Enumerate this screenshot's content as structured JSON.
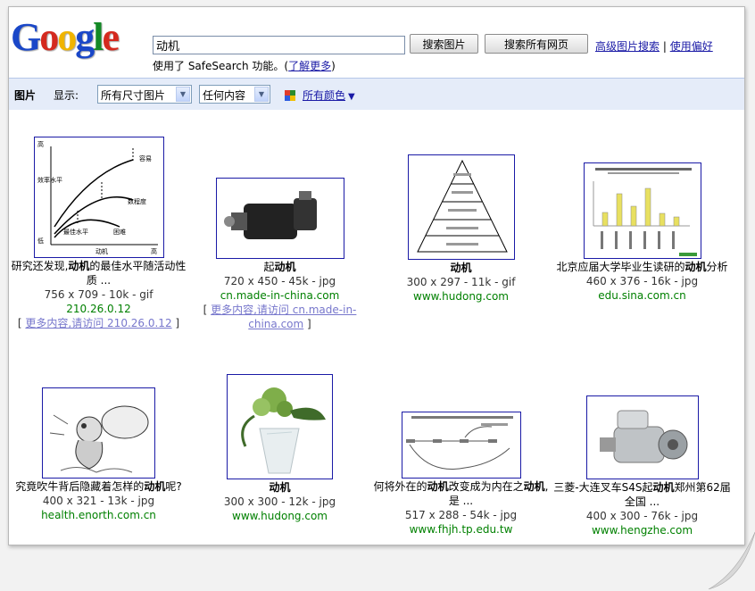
{
  "header": {
    "logo": [
      "G",
      "o",
      "o",
      "g",
      "l",
      "e"
    ],
    "logo_colors": [
      "#1a47c8",
      "#d42a1f",
      "#f0b400",
      "#1a47c8",
      "#138a26",
      "#d42a1f"
    ],
    "search_value": "动机",
    "btn_search_images": "搜索图片",
    "btn_search_web": "搜索所有网页",
    "link_advanced": "高级图片搜索",
    "separator": "|",
    "link_prefs": "使用偏好",
    "safesearch_prefix": "使用了  SafeSearch 功能。(",
    "safesearch_link": "了解更多",
    "safesearch_suffix": ")"
  },
  "toolbar": {
    "title": "图片",
    "show_label": "显示:",
    "size_select": "所有尺寸图片",
    "type_select": "任何内容",
    "color_link": "所有颜色",
    "color_arrow": "▼",
    "color_squares": [
      "#e03c2c",
      "#2c8c2c",
      "#2c5ce0",
      "#f0c000"
    ]
  },
  "results": [
    {
      "cap_pre": "研究还发现,",
      "cap_bold": "动机",
      "cap_post": "的最佳水平随活动性质  ...",
      "meta": "756 x 709 - 10k - gif",
      "host": "210.26.0.12",
      "more_pre": "[ ",
      "more_link": "更多内容,请访问  210.26.0.12",
      "more_post": " ]",
      "icon": "motivation-curve-chart-thumbnail",
      "chart_axis": [
        "高",
        "效率水平",
        "低",
        "动机",
        "高"
      ],
      "chart_labels": [
        "容易",
        "数程度",
        "最佳水平",
        "困难"
      ]
    },
    {
      "cap_pre": "起",
      "cap_bold": "动机",
      "cap_post": "",
      "meta": "720 x 450 - 45k - jpg",
      "host": "cn.made-in-china.com",
      "more_pre": "[ ",
      "more_link": "更多内容,请访问  cn.made-in-china.com",
      "more_post": " ]",
      "icon": "starter-motor-photo-thumbnail"
    },
    {
      "cap_pre": "",
      "cap_bold": "动机",
      "cap_post": "",
      "meta": "300 x 297 - 11k - gif",
      "host": "www.hudong.com",
      "icon": "maslow-pyramid-thumbnail"
    },
    {
      "cap_pre": "北京应届大学毕业生读研的",
      "cap_bold": "动机",
      "cap_post": "分析",
      "meta": "460 x 376 - 16k - jpg",
      "host": "edu.sina.com.cn",
      "icon": "bar-chart-thumbnail"
    },
    {
      "cap_pre": "究竟吹牛背后隐藏着怎样的",
      "cap_bold": "动机",
      "cap_post": "呢?",
      "meta": "400 x 321 - 13k - jpg",
      "host": "health.enorth.com.cn",
      "icon": "cartoon-drawing-thumbnail"
    },
    {
      "cap_pre": "",
      "cap_bold": "动机",
      "cap_post": "",
      "meta": "300 x 300 - 12k - jpg",
      "host": "www.hudong.com",
      "icon": "flower-arrangement-thumbnail"
    },
    {
      "cap_pre": "何将外在的",
      "cap_bold": "动机",
      "cap_post": "改变成为内在之",
      "cap2_bold": "动机",
      "cap2_post": ",是  ...",
      "meta": "517 x 288 - 54k - jpg",
      "host": "www.fhjh.tp.edu.tw",
      "icon": "flow-diagram-thumbnail"
    },
    {
      "cap_pre": "三菱-大连叉车S4S起",
      "cap_bold": "动机",
      "cap_post": "郑州第62届全国  ...",
      "meta": "400 x 300 - 76k - jpg",
      "host": "www.hengzhe.com",
      "icon": "starter-motor-photo-thumbnail"
    }
  ]
}
